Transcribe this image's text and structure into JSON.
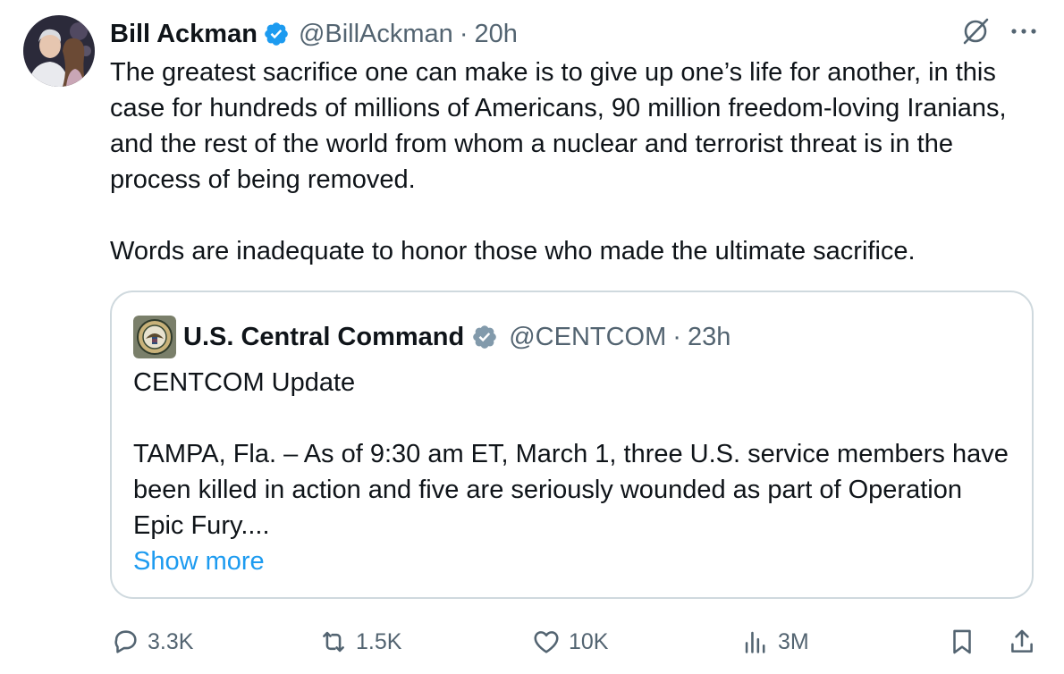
{
  "author": {
    "display_name": "Bill Ackman",
    "handle": "@BillAckman",
    "separator": "·",
    "time": "20h",
    "verified_color": "#1d9bf0"
  },
  "tweet": {
    "paragraph1": "The greatest sacrifice one can make is to give up one’s life for another, in this case for hundreds of millions of Americans, 90 million freedom-loving Iranians, and the rest of the world from whom a nuclear and terrorist threat is in the process of being removed.",
    "paragraph2": "Words are inadequate to honor those who made the ultimate sacrifice."
  },
  "quote": {
    "display_name": "U.S. Central Command",
    "handle": "@CENTCOM",
    "separator": "·",
    "time": "23h",
    "verified_color": "#829aab",
    "line1": "CENTCOM Update",
    "body": "TAMPA, Fla. – As of 9:30 am ET, March 1, three U.S. service members have been killed in action and five are seriously wounded as part of Operation Epic Fury....",
    "show_more": "Show more"
  },
  "actions": {
    "replies": "3.3K",
    "reposts": "1.5K",
    "likes": "10K",
    "views": "3M"
  },
  "icons": {
    "grok": "grok-icon",
    "more": "more-icon",
    "reply": "reply-icon",
    "repost": "repost-icon",
    "like": "like-icon",
    "views": "views-icon",
    "bookmark": "bookmark-icon",
    "share": "share-icon"
  },
  "colors": {
    "text": "#0f1419",
    "secondary": "#536471",
    "link": "#1d9bf0",
    "border": "#cfd9de"
  }
}
